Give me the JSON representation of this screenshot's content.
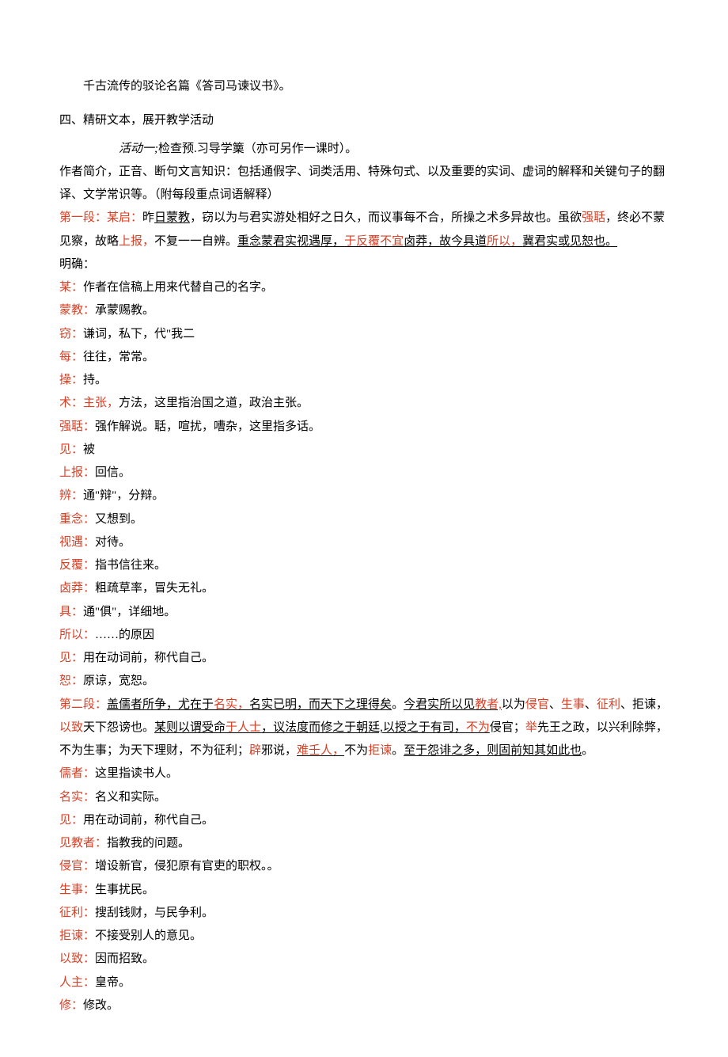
{
  "line1": "千古流传的驳论名篇《答司马谏议书》。",
  "heading4": "四、精研文本，展开教学活动",
  "activity_label": "活动一;",
  "activity_rest": "检查预.习导学篥（亦可另作一课时）。",
  "intro1": "作者简介，正音、断句文言知识：包括通假字、词类活用、特殊句式、以及重要的实词、虚词的解释和关键句子的翻译、文学常识等。（附每段重点词语解释）",
  "p1_label": "第一段：",
  "p1_a": "某启：",
  "p1_b": "昨",
  "p1_c": "日蒙教",
  "p1_d": "，窃以为与君实游处相好之日久，而议事每不合，所操之术多异故也。虽欲",
  "p1_e": "强聒",
  "p1_f": "，终必不蒙见察，故略",
  "p1_g": "上报，",
  "p1_h": "不复一一自辨。",
  "p1_i": "重念蒙君实视遇厚，",
  "p1_j": "于反覆不宜",
  "p1_k": "卤莽，故今具道",
  "p1_l": "所以，",
  "p1_m": "冀君实或见恕也。",
  "mingque": "明确：",
  "g_mou_k": "某：",
  "g_mou_v": "作者在信稿上用来代替自己的名字。",
  "g_mengjiao_k": "蒙教：",
  "g_mengjiao_v": "承蒙赐教。",
  "g_qie_k": "窃：",
  "g_qie_v": "谦词，私下，代\"我二",
  "g_mei_k": "每：",
  "g_mei_v": "往往，常常。",
  "g_cao_k": "操：",
  "g_cao_v": "持。",
  "g_shu_k1": "术：",
  "g_shu_k2": "主张，",
  "g_shu_v": "方法，这里指治国之道，政治主张。",
  "g_qiangguo_k": "强聒：",
  "g_qiangguo_v": "强作解说。聒，喧扰，嘈杂，这里指多话。",
  "g_jian_k": "见：",
  "g_jian_v": "被",
  "g_shangbao_k": "上报：",
  "g_shangbao_v": "回信。",
  "g_bian_k": "辨：",
  "g_bian_v": "通\"辩\"，分辩。",
  "g_chongnian_k": "重念：",
  "g_chongnian_v": "又想到。",
  "g_shiyu_k": "视遇：",
  "g_shiyu_v": "对待。",
  "g_fanfu_k": "反覆：",
  "g_fanfu_v": "指书信往来。",
  "g_lumang_k": "卤莽：",
  "g_lumang_v": "粗疏草率，冒失无礼。",
  "g_ju_k": "具：",
  "g_ju_v": "通\"俱\"，详细地。",
  "g_suoyi_k": "所以：",
  "g_suoyi_v": "……的原因",
  "g_jian2_k": "见：",
  "g_jian2_v": "用在动词前，称代自己。",
  "g_shu2_k": "恕：",
  "g_shu2_v": "原谅，宽恕。",
  "p2_label": "第二段：",
  "p2_a": "盖儒者所争，尤在于",
  "p2_b": "名实，",
  "p2_c": "名实已明，而天下之理得矣",
  "p2_d": "。",
  "p2_e": "今君实所以见",
  "p2_f": "教者,",
  "p2_g": "以为",
  "p2_h": "侵官",
  "p2_i": "、",
  "p2_j": "生事",
  "p2_k": "、",
  "p2_l": "征利",
  "p2_m": "、拒谏，",
  "p2_n": "以致",
  "p2_o": "天下怨谤也。",
  "p2_p": "某则以谓受命",
  "p2_q": "于人士",
  "p2_r": "，议法度而修之于朝廷,",
  "p2_s": "以授之于有司，",
  "p2_t": "不为",
  "p2_u": "侵官；",
  "p2_v": "举",
  "p2_w": "先王之政，以兴利除弊，不为生事；为天下理财，不为征利；",
  "p2_x": "辟",
  "p2_y": "邪说，",
  "p2_z": "难壬人，",
  "p2_aa": "不为",
  "p2_ab": "拒谏",
  "p2_ac": "。",
  "p2_ad": "至于怨诽之多，则固前知其如此也",
  "p2_ae": "。",
  "g_ruzhe_k": "儒者：",
  "g_ruzhe_v": "这里指读书人。",
  "g_mingshi_k": "名实：",
  "g_mingshi_v": "名义和实际。",
  "g_jian3_k": "见：",
  "g_jian3_v": "用在动词前，称代自己。",
  "g_jianjiao_k": "见教者：",
  "g_jianjiao_v": "指教我的问题。",
  "g_qinguan_k": "侵官：",
  "g_qinguan_v": "增设新官，侵犯原有官吏的职权。。",
  "g_shengshi_k": "生事：",
  "g_shengshi_v": "生事扰民。",
  "g_zhengli_k": "征利：",
  "g_zhengli_v": "搜刮钱财，与民争利。",
  "g_jujian_k": "拒谏：",
  "g_jujian_v": "不接受别人的意见。",
  "g_yizhi_k": "以致：",
  "g_yizhi_v": "因而招致。",
  "g_renzhu_k": "人主：",
  "g_renzhu_v": "皇帝。",
  "g_xiu_k": "修：",
  "g_xiu_v": "修改。"
}
